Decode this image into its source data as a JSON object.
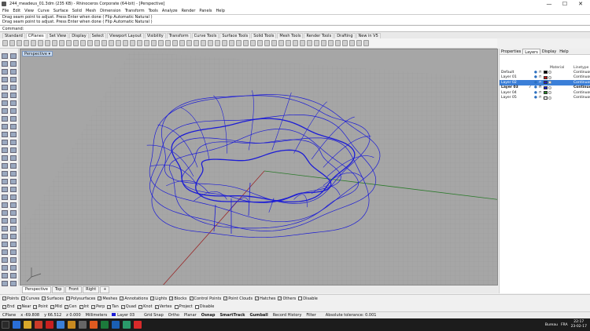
{
  "window": {
    "title": "244_meadeus_01.3dm (235 KB) - Rhinoceros Corporate (64-bit) - [Perspective]",
    "minimize": "—",
    "maximize": "☐",
    "close": "✕"
  },
  "menu": [
    "File",
    "Edit",
    "View",
    "Curve",
    "Surface",
    "Solid",
    "Mesh",
    "Dimension",
    "Transform",
    "Tools",
    "Analyze",
    "Render",
    "Panels",
    "Help"
  ],
  "command_history": [
    "Drag seam point to adjust. Press Enter when done ( Flip Automatic Natural )",
    "Drag seam point to adjust. Press Enter when done ( Flip Automatic Natural )"
  ],
  "command_prompt": "Command:",
  "toolbar_tabs": [
    "Standard",
    "CPlanes",
    "Set View",
    "Display",
    "Select",
    "Viewport Layout",
    "Visibility",
    "Transform",
    "Curve Tools",
    "Surface Tools",
    "Solid Tools",
    "Mesh Tools",
    "Render Tools",
    "Drafting",
    "New in V5"
  ],
  "active_toolbar_tab": "CPlanes",
  "viewport": {
    "label": "Perspective",
    "tabs": [
      "Perspective",
      "Top",
      "Front",
      "Right"
    ],
    "add_tab": "+",
    "background": "#a6a6a6",
    "curve_color": "#1c1cd6"
  },
  "panel": {
    "tabs": [
      "Properties",
      "Layers",
      "Display",
      "Help"
    ],
    "active_tab": "Layers",
    "columns": {
      "name": "",
      "material": "Material",
      "linetype": "Linetype"
    },
    "layers": [
      {
        "name": "Default",
        "current": false,
        "selected": false,
        "check": "",
        "color": "#000000",
        "linetype": "Continuous"
      },
      {
        "name": "Layer 01",
        "current": false,
        "selected": false,
        "check": "",
        "color": "#cc1111",
        "linetype": "Continuous"
      },
      {
        "name": "Layer 02",
        "current": false,
        "selected": true,
        "check": "",
        "color": "#1c1cd6",
        "linetype": "Continuous"
      },
      {
        "name": "Layer 03",
        "current": true,
        "selected": false,
        "check": "✓",
        "color": "#1c1cd6",
        "linetype": "Continuous"
      },
      {
        "name": "Layer 04",
        "current": false,
        "selected": false,
        "check": "",
        "color": "#2a8a2a",
        "linetype": "Continuous"
      },
      {
        "name": "Layer 05",
        "current": false,
        "selected": false,
        "check": "",
        "color": "#ffffff",
        "linetype": "Continuous"
      }
    ]
  },
  "object_snaps": [
    {
      "label": "Points",
      "checked": true
    },
    {
      "label": "Curves",
      "checked": true
    },
    {
      "label": "Surfaces",
      "checked": true
    },
    {
      "label": "Polysurfaces",
      "checked": true
    },
    {
      "label": "Meshes",
      "checked": true
    },
    {
      "label": "Annotations",
      "checked": true
    },
    {
      "label": "Lights",
      "checked": true
    },
    {
      "label": "Blocks",
      "checked": true
    },
    {
      "label": "Control Points",
      "checked": true
    },
    {
      "label": "Point Clouds",
      "checked": true
    },
    {
      "label": "Hatches",
      "checked": true
    },
    {
      "label": "Others",
      "checked": true
    },
    {
      "label": "Disable",
      "checked": false
    }
  ],
  "osnap_modes": [
    {
      "label": "End",
      "checked": true
    },
    {
      "label": "Near",
      "checked": true
    },
    {
      "label": "Point",
      "checked": true
    },
    {
      "label": "Mid",
      "checked": true
    },
    {
      "label": "Cen",
      "checked": true
    },
    {
      "label": "Int",
      "checked": true
    },
    {
      "label": "Perp",
      "checked": true
    },
    {
      "label": "Tan",
      "checked": true
    },
    {
      "label": "Quad",
      "checked": true
    },
    {
      "label": "Knot",
      "checked": true
    },
    {
      "label": "Vertex",
      "checked": true
    },
    {
      "label": "Project",
      "checked": false
    },
    {
      "label": "Disable",
      "checked": false
    }
  ],
  "status": {
    "cplane": "CPlane",
    "x": "x -69.808",
    "y": "y 66.512",
    "z": "z 0.000",
    "units": "Millimeters",
    "layer": "Layer 03",
    "toggles": [
      "Grid Snap",
      "Ortho",
      "Planar",
      "Osnap",
      "SmartTrack",
      "Gumball",
      "Record History",
      "Filter"
    ],
    "bold_toggles": [
      "Osnap",
      "SmartTrack",
      "Gumball"
    ],
    "tolerance": "Absolute tolerance: 0.001"
  },
  "taskbar": {
    "app_colors": [
      "#2a6fd8",
      "#d8a82a",
      "#cc3b2a",
      "#c82020",
      "#3b7fd8",
      "#c88a20",
      "#666666",
      "#e05a20",
      "#1c7a3b",
      "#1a5fb4",
      "#2a9a6a",
      "#d82a2a"
    ],
    "desktop_label": "Bureau",
    "language": "FRA",
    "time": "22:17",
    "date": "23-02-17"
  }
}
